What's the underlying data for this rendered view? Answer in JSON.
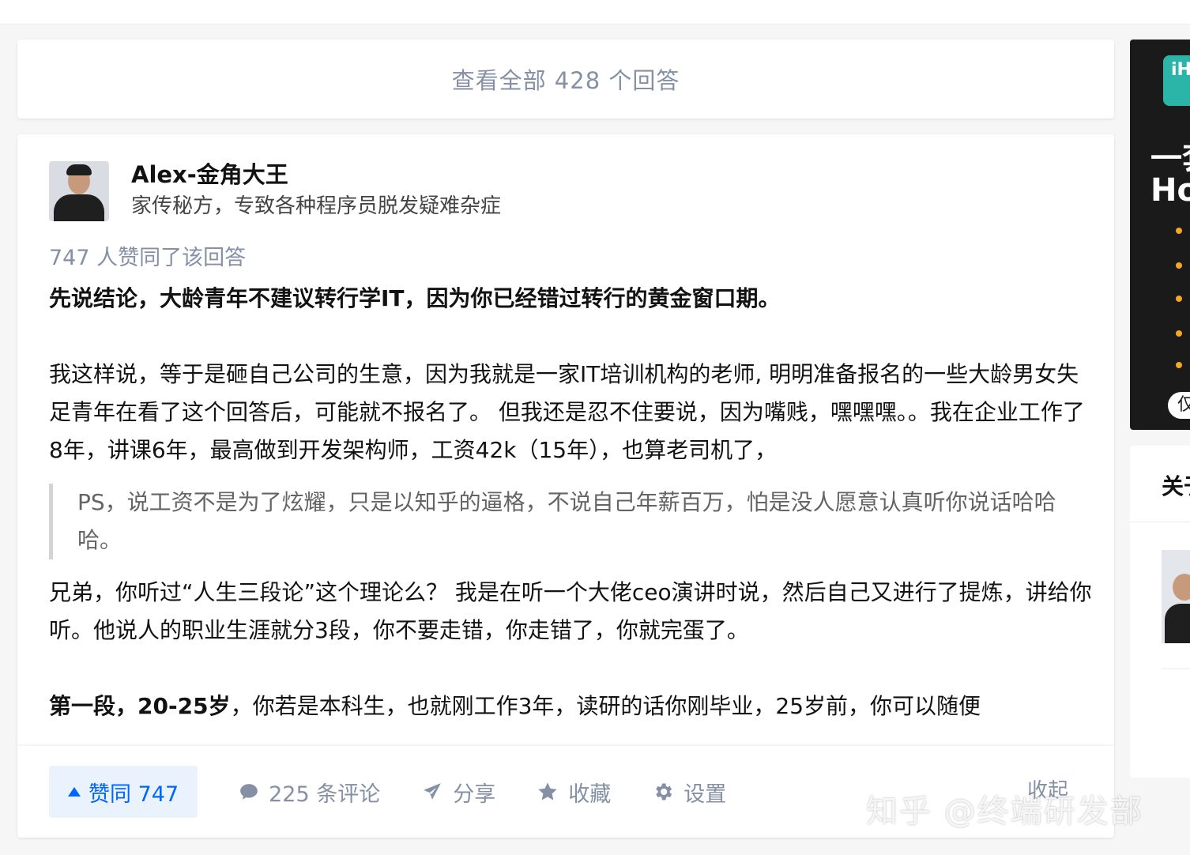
{
  "view_all": {
    "label": "查看全部 428 个回答"
  },
  "answer": {
    "author": {
      "name": "Alex-金角大王",
      "bio": "家传秘方，专致各种程序员脱发疑难杂症"
    },
    "votes_info": "747 人赞同了该回答",
    "paragraphs": {
      "p1": "先说结论，大龄青年不建议转行学IT，因为你已经错过转行的黄金窗口期。",
      "p2": "我这样说，等于是砸自己公司的生意，因为我就是一家IT培训机构的老师, 明明准备报名的一些大龄男女失足青年在看了这个回答后，可能就不报名了。 但我还是忍不住要说，因为嘴贱，嘿嘿嘿。。我在企业工作了8年，讲课6年，最高做到开发架构师，工资42k（15年），也算老司机了，",
      "quote": "PS，说工资不是为了炫耀，只是以知乎的逼格，不说自己年薪百万，怕是没人愿意认真听你说话哈哈哈。",
      "p3": "兄弟，你听过“人生三段论”这个理论么？ 我是在听一个大佬ceo演讲时说，然后自己又进行了提炼，讲给你听。他说人的职业生涯就分3段，你不要走错，你走错了，你就完蛋了。",
      "p4_bold": "第一段，20-25岁",
      "p4_rest": "，你若是本科生，也就刚工作3年，读研的话你刚毕业，25岁前，你可以随便"
    },
    "actions": {
      "vote": "赞同 747",
      "comments": "225 条评论",
      "share": "分享",
      "favorite": "收藏",
      "settings": "设置",
      "collapse": "收起"
    }
  },
  "watermark": "知乎 @终端研发部",
  "sidebar": {
    "ad": {
      "logo_text": "iH",
      "line1": "一套",
      "line2": "Ho",
      "pill": "仅"
    },
    "about": {
      "title": "关于"
    }
  },
  "colors": {
    "accent": "#0066ff",
    "muted": "#8590a6",
    "text": "#121212"
  }
}
